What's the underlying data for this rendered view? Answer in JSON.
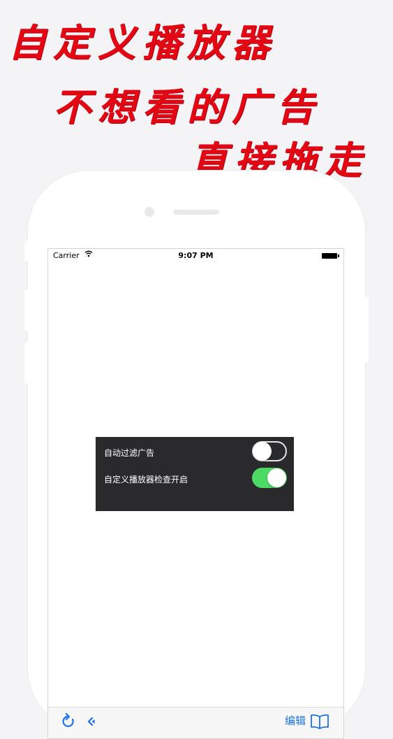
{
  "promo": {
    "line1": "自定义播放器",
    "line2": "不想看的广告",
    "line3": "直接拖走",
    "color": "#e30613"
  },
  "status_bar": {
    "carrier": "Carrier",
    "time": "9:07 PM",
    "wifi_icon": "wifi-icon",
    "battery_icon": "battery-icon"
  },
  "settings": {
    "panel_color": "#2a2a2c",
    "rows": [
      {
        "label": "自动过滤广告",
        "enabled": false
      },
      {
        "label": "自定义播放器检查开启",
        "enabled": true
      }
    ],
    "toggle_on_color": "#4cd964"
  },
  "toolbar": {
    "refresh_icon": "refresh-icon",
    "back_icon": "back-icon",
    "edit_label": "编辑",
    "bookmarks_icon": "bookmarks-icon",
    "accent": "#1a73e8"
  }
}
